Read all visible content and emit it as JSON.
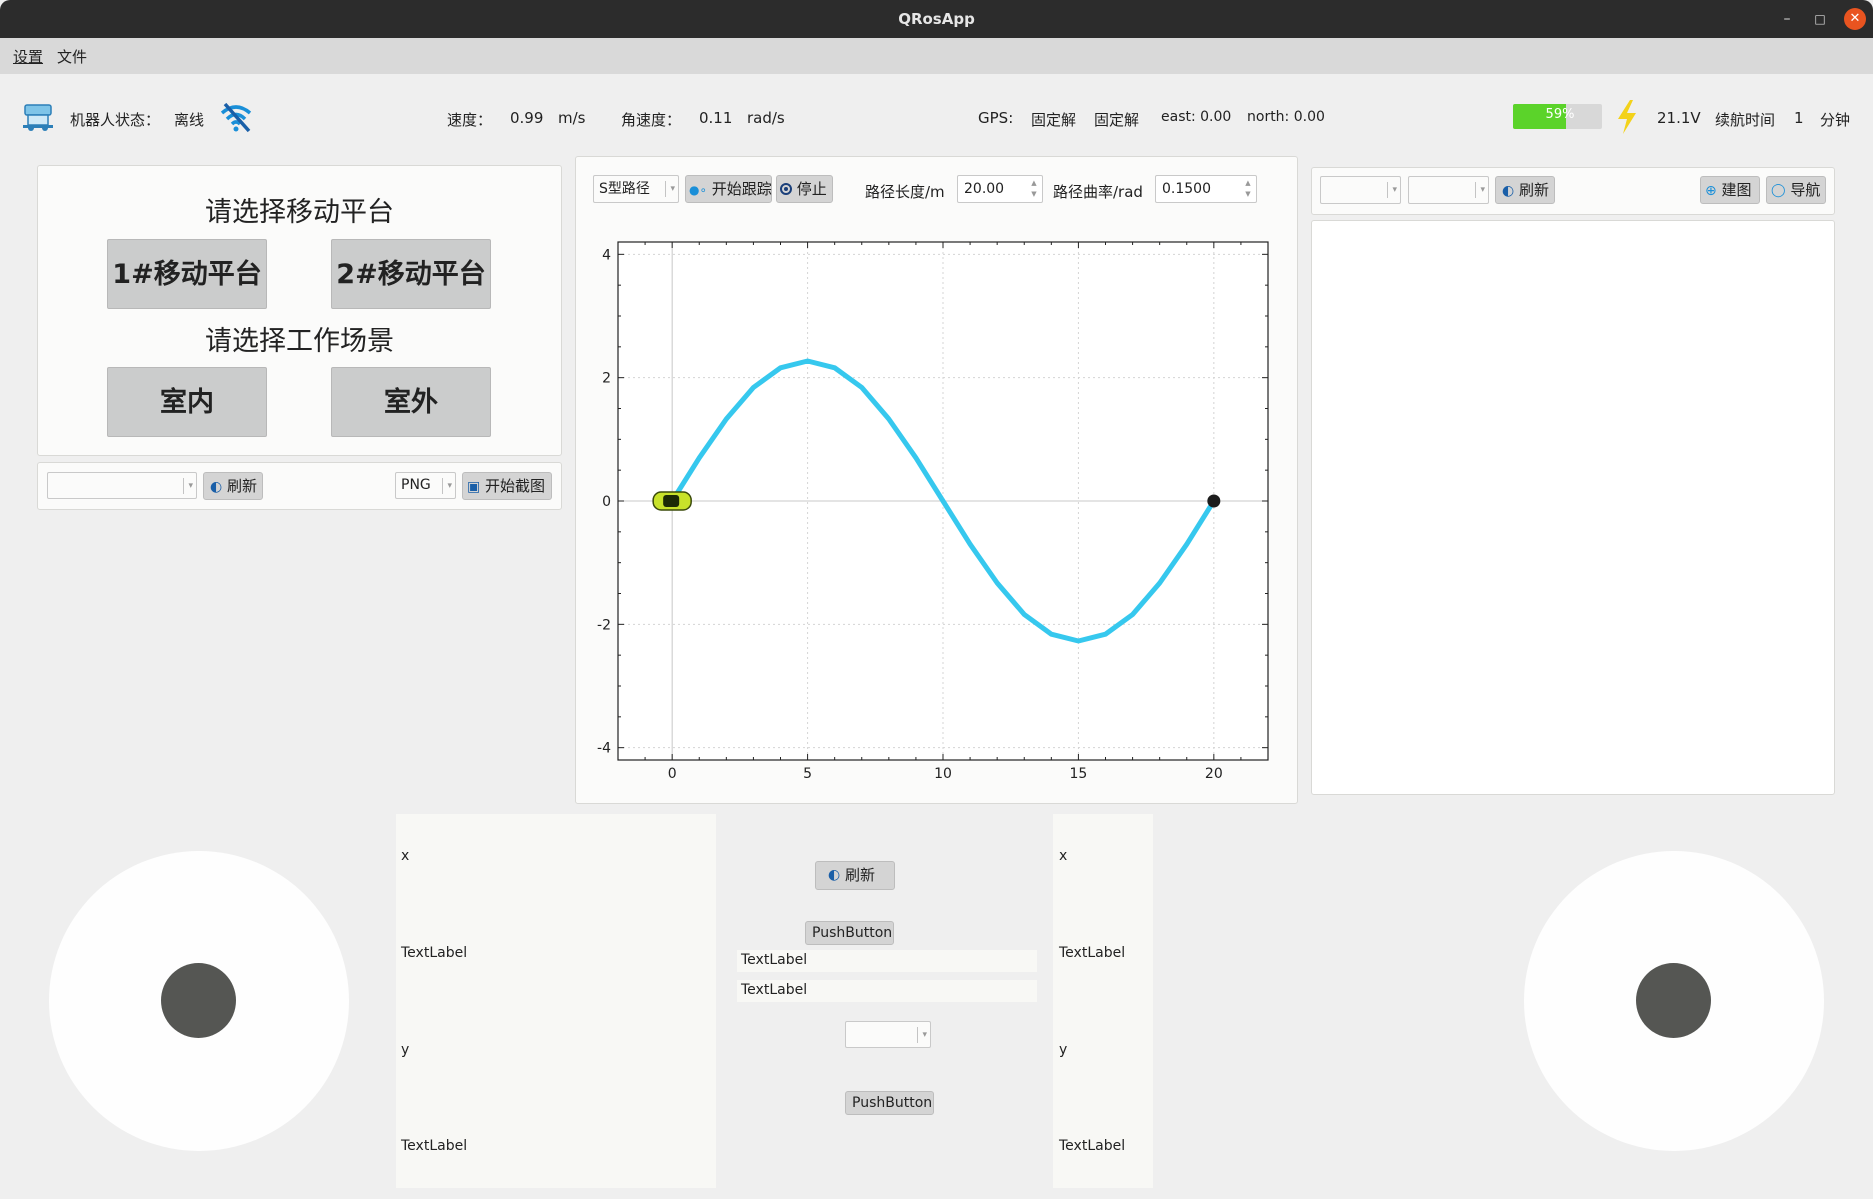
{
  "window": {
    "title": "QRosApp"
  },
  "menu": [
    "设置",
    "文件"
  ],
  "status": {
    "robot_label": "机器人状态：",
    "robot_value": "离线",
    "speed_label": "速度：",
    "speed_value": "0.99",
    "speed_unit": "m/s",
    "ang_label": "角速度：",
    "ang_value": "0.11",
    "ang_unit": "rad/s",
    "gps_label": "GPS:",
    "gps_v1": "固定解",
    "gps_v2": "固定解",
    "east": "east: 0.00",
    "north": "north: 0.00",
    "battery_text": "59%",
    "battery_level": 0.59,
    "voltage": "21.1V",
    "endurance_label": "续航时间",
    "endurance_value": "1",
    "endurance_unit": "分钟"
  },
  "left_panel": {
    "platform_title": "请选择移动平台",
    "platform1": "1#移动平台",
    "platform2": "2#移动平台",
    "scene_title": "请选择工作场景",
    "indoor": "室内",
    "outdoor": "室外"
  },
  "capture_bar": {
    "camera_value": "",
    "refresh": "刷新",
    "format": "PNG",
    "capture": "开始截图"
  },
  "path_bar": {
    "path_type": "S型路径",
    "start": "开始跟踪",
    "stop": "停止",
    "length_label": "路径长度/m",
    "length_value": "20.00",
    "curv_label": "路径曲率/rad",
    "curv_value": "0.1500"
  },
  "map_bar": {
    "select1": "",
    "select2": "",
    "refresh": "刷新",
    "build": "建图",
    "navigate": "导航"
  },
  "bottom": {
    "left_x": "x",
    "left_tl1": "TextLabel",
    "left_y": "y",
    "left_tl2": "TextLabel",
    "mid_refresh": "刷新",
    "mid_push1": "PushButton",
    "mid_tl1": "TextLabel",
    "mid_tl2": "TextLabel",
    "mid_combo": "",
    "mid_push2": "PushButton",
    "right_x": "x",
    "right_tl1": "TextLabel",
    "right_y": "y",
    "right_tl2": "TextLabel"
  },
  "colors": {
    "curve": "#36c8ee",
    "battery": "#5bd32a",
    "bolt": "#f3d21a",
    "close": "#e95420",
    "car": "#c8e22a"
  },
  "chart_data": {
    "type": "line",
    "series": [
      {
        "x": [
          0,
          1,
          2,
          3,
          4,
          5,
          6,
          7,
          8,
          9,
          10,
          11,
          12,
          13,
          14,
          15,
          16,
          17,
          18,
          19,
          20
        ],
        "y": [
          0,
          0.7,
          1.33,
          1.84,
          2.16,
          2.27,
          2.16,
          1.84,
          1.33,
          0.7,
          0,
          -0.7,
          -1.33,
          -1.84,
          -2.16,
          -2.27,
          -2.16,
          -1.84,
          -1.33,
          -0.7,
          0
        ]
      }
    ],
    "xlim": [
      -2,
      22
    ],
    "ylim": [
      -4.2,
      4.2
    ],
    "xticks": [
      0,
      5,
      10,
      15,
      20
    ],
    "yticks": [
      -4,
      -2,
      0,
      2,
      4
    ],
    "grid": true,
    "markers": {
      "vehicle": [
        0,
        0
      ],
      "end": [
        20,
        0
      ]
    }
  }
}
